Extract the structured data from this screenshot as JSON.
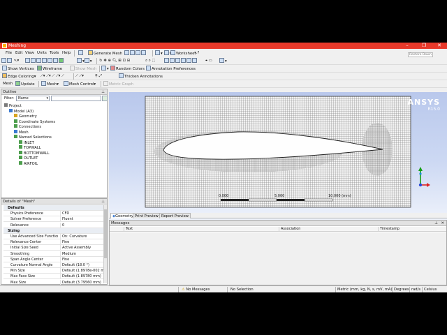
{
  "window": {
    "title": "Meshing",
    "tooltip": "Restore Down"
  },
  "menu": [
    "File",
    "Edit",
    "View",
    "Units",
    "Tools",
    "Help"
  ],
  "toolbar1": {
    "generate_mesh": "Generate Mesh",
    "worksheet": "Worksheet"
  },
  "toolbar2": {
    "show_vertices": "Show Vertices",
    "wireframe": "Wireframe",
    "show_mesh": "Show Mesh",
    "random_colors": "Random Colors",
    "annotation_preferences": "Annotation Preferences"
  },
  "toolbar3": {
    "edge_coloring": "Edge Coloring",
    "thicken_annotations": "Thicken Annotations"
  },
  "toolbar4": {
    "mesh": "Mesh",
    "update": "Update",
    "mesh_menu": "Mesh",
    "mesh_control": "Mesh Control",
    "metric_graph": "Metric Graph"
  },
  "outline": {
    "title": "Outline",
    "filter_label": "Filter:",
    "filter_value": "Name",
    "nodes": [
      {
        "label": "Project",
        "level": 0,
        "color": "#7a7a7a"
      },
      {
        "label": "Model (A3)",
        "level": 1,
        "color": "#3b7ad1"
      },
      {
        "label": "Geometry",
        "level": 2,
        "color": "#d9a520"
      },
      {
        "label": "Coordinate Systems",
        "level": 2,
        "color": "#4c9e4c"
      },
      {
        "label": "Connections",
        "level": 2,
        "color": "#4c9e4c"
      },
      {
        "label": "Mesh",
        "level": 2,
        "color": "#3b7ad1"
      },
      {
        "label": "Named Selections",
        "level": 2,
        "color": "#4c9e4c"
      },
      {
        "label": "INLET",
        "level": 3,
        "color": "#4c9e4c"
      },
      {
        "label": "TOPWALL",
        "level": 3,
        "color": "#4c9e4c"
      },
      {
        "label": "BOTTOMWALL",
        "level": 3,
        "color": "#4c9e4c"
      },
      {
        "label": "OUTLET",
        "level": 3,
        "color": "#4c9e4c"
      },
      {
        "label": "AIRFOIL",
        "level": 3,
        "color": "#4c9e4c"
      }
    ]
  },
  "details": {
    "title": "Details of \"Mesh\"",
    "rows": [
      {
        "key": "Defaults",
        "value": "",
        "section": true
      },
      {
        "key": "Physics Preference",
        "value": "CFD"
      },
      {
        "key": "Solver Preference",
        "value": "Fluent"
      },
      {
        "key": "Relevance",
        "value": "0"
      },
      {
        "key": "Sizing",
        "value": "",
        "section": true
      },
      {
        "key": "Use Advanced Size Function",
        "value": "On: Curvature"
      },
      {
        "key": "Relevance Center",
        "value": "Fine"
      },
      {
        "key": "Initial Size Seed",
        "value": "Active Assembly"
      },
      {
        "key": "Smoothing",
        "value": "Medium"
      },
      {
        "key": "Span Angle Center",
        "value": "Fine"
      },
      {
        "key": "Curvature Normal Angle",
        "value": "Default (18.0 °)"
      },
      {
        "key": "Min Size",
        "value": "Default (1.8978e-002 mm)"
      },
      {
        "key": "Max Face Size",
        "value": "Default (1.89780 mm)"
      },
      {
        "key": "Max Size",
        "value": "Default (3.79560 mm)"
      }
    ]
  },
  "viewport": {
    "logo": "ANSYS",
    "version": "R15.0",
    "scale_start": "0.000",
    "scale_mid": "5.000",
    "scale_end": "10.000 (mm)"
  },
  "tabs": [
    "Geometry",
    "Print Preview",
    "Report Preview"
  ],
  "messages": {
    "title": "Messages",
    "columns": [
      "Text",
      "Association",
      "Timestamp"
    ]
  },
  "status": {
    "messages": "No Messages",
    "selection": "No Selection",
    "units": "Metric (mm, kg, N, s, mV, mA)",
    "angle": "Degrees",
    "angular_velocity": "rad/s",
    "temperature": "Celsius"
  },
  "colors": {
    "titlebar": "#e8392a",
    "viewport_top": "#b9c8ec",
    "viewport_bottom": "#ffffff",
    "mesh_fill": "#f4f4f4",
    "mesh_line": "#6c6c6c"
  }
}
